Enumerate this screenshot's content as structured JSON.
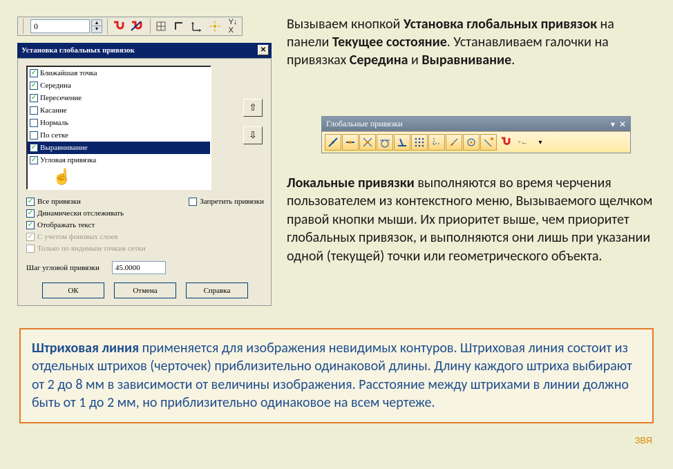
{
  "top_toolbar": {
    "value": "0"
  },
  "dialog": {
    "title": "Установка глобальных привязок",
    "snaps": [
      {
        "label": "Ближайшая точка",
        "checked": true
      },
      {
        "label": "Середина",
        "checked": true
      },
      {
        "label": "Пересечение",
        "checked": true
      },
      {
        "label": "Касание",
        "checked": false
      },
      {
        "label": "Нормаль",
        "checked": false
      },
      {
        "label": "По сетке",
        "checked": false
      },
      {
        "label": "Выравнивание",
        "checked": true,
        "selected": true
      },
      {
        "label": "Угловая привязка",
        "checked": true
      }
    ],
    "opts": {
      "all": "Все привязки",
      "forbid": "Запретить привязки",
      "dynamic": "Динамически отслеживать",
      "text": "Отображать текст",
      "bg": "С учетом фоновых слоев",
      "grid": "Только по видимым точкам сетки"
    },
    "step": {
      "label": "Шаг угловой привязки",
      "value": "45.0000"
    },
    "btns": {
      "ok": "ОК",
      "cancel": "Отмена",
      "help": "Справка"
    }
  },
  "global_panel": {
    "title": "Глобальные привязки"
  },
  "text1": {
    "t1": "Вызываем кнопкой ",
    "b1": "Установка глобальных привязок",
    "t2": " на панели ",
    "b2": "Текущее состояние",
    "t3": ". Устанавливаем галочки на привязках ",
    "b3": "Середина",
    "t4": " и ",
    "b4": "Выравнивание",
    "t5": "."
  },
  "text2": {
    "b1": "Локальные привязки ",
    "rest": "выполняются  во время черчения пользователем из контекстного меню, Вызываемого щелчком правой кнопки мыши. Их приоритет выше, чем приоритет глобальных привязок,  и выполняются они лишь при указании одной (текущей) точки или геометрического объекта."
  },
  "bluebox": {
    "b1": "Штриховая линия ",
    "rest": "применяется для изображения невидимых контуров. Штриховая линия состоит из отдельных штрихов (черточек) приблизительно одинаковой длины. Длину каждого штриха выбирают от 2 до 8 мм в зависимости от величины изображения. Расстояние между штрихами в линии должно быть от 1 до 2 мм, но приблизительно одинаковое на всем чертеже."
  },
  "footer": "ЗВЯ"
}
